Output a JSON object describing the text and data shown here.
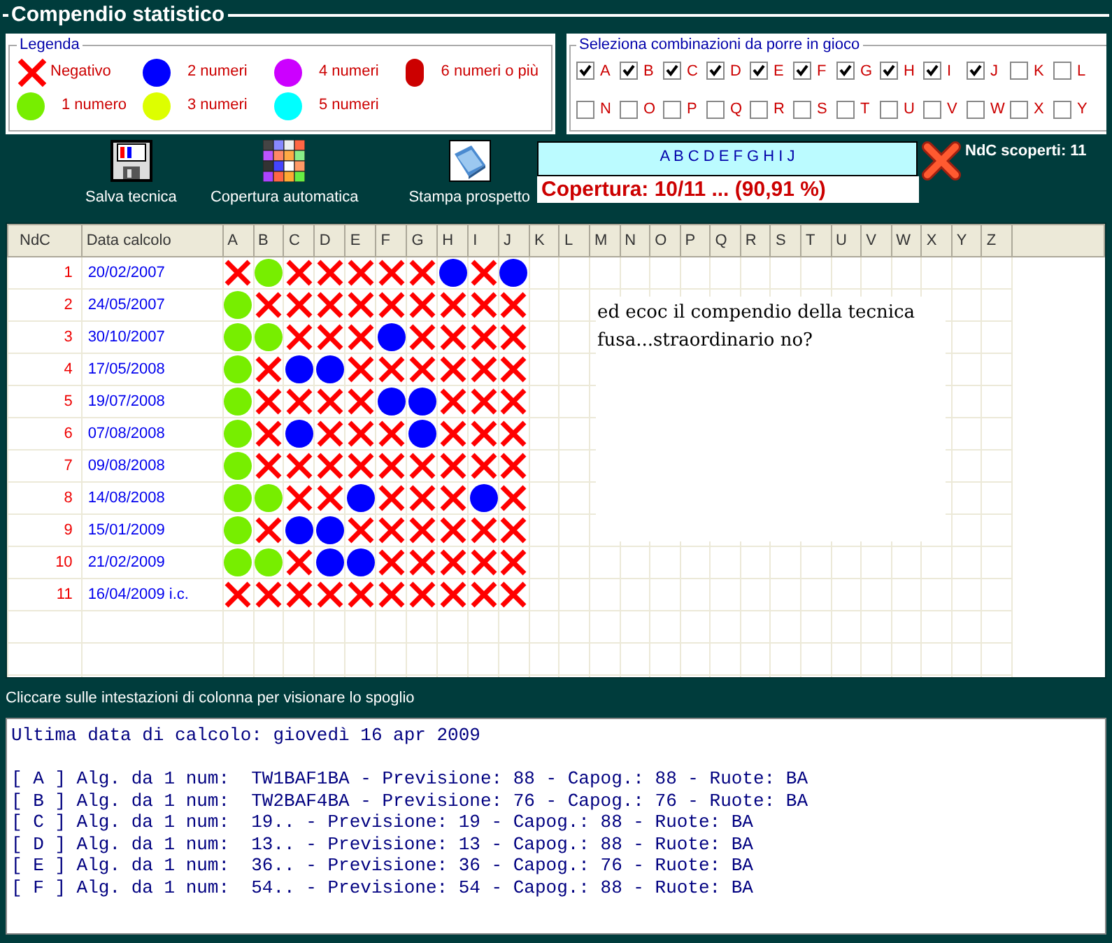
{
  "window": {
    "title": "Compendio statistico"
  },
  "legend": {
    "title": "Legenda",
    "items": [
      {
        "kind": "cross",
        "label": "Negativo",
        "color": "#ff0000"
      },
      {
        "kind": "dot",
        "label": "2 numeri",
        "color": "#0000ff"
      },
      {
        "kind": "dot",
        "label": "4 numeri",
        "color": "#cc00ff"
      },
      {
        "kind": "dot",
        "label": "6 numeri o più",
        "color": "#cc0000"
      },
      {
        "kind": "dot",
        "label": "1 numero",
        "color": "#77ee00"
      },
      {
        "kind": "dot",
        "label": "3 numeri",
        "color": "#ddff00"
      },
      {
        "kind": "dot",
        "label": "5 numeri",
        "color": "#00ffff"
      }
    ]
  },
  "selection": {
    "title": "Seleziona combinazioni da porre in gioco",
    "rows": [
      [
        {
          "label": "A",
          "checked": true
        },
        {
          "label": "B",
          "checked": true
        },
        {
          "label": "C",
          "checked": true
        },
        {
          "label": "D",
          "checked": true
        },
        {
          "label": "E",
          "checked": true
        },
        {
          "label": "F",
          "checked": true
        },
        {
          "label": "G",
          "checked": true
        },
        {
          "label": "H",
          "checked": true
        },
        {
          "label": "I",
          "checked": true
        },
        {
          "label": "J",
          "checked": true
        },
        {
          "label": "K",
          "checked": false
        },
        {
          "label": "L",
          "checked": false
        }
      ],
      [
        {
          "label": "N",
          "checked": false
        },
        {
          "label": "O",
          "checked": false
        },
        {
          "label": "P",
          "checked": false
        },
        {
          "label": "Q",
          "checked": false
        },
        {
          "label": "R",
          "checked": false
        },
        {
          "label": "S",
          "checked": false
        },
        {
          "label": "T",
          "checked": false
        },
        {
          "label": "U",
          "checked": false
        },
        {
          "label": "V",
          "checked": false
        },
        {
          "label": "W",
          "checked": false
        },
        {
          "label": "X",
          "checked": false
        },
        {
          "label": "Y",
          "checked": false
        }
      ]
    ]
  },
  "toolbar": [
    {
      "kind": "floppy",
      "label": "Salva tecnica"
    },
    {
      "kind": "palette",
      "label": "Copertura automatica"
    },
    {
      "kind": "book",
      "label": "Stampa prospetto"
    }
  ],
  "combination": "A B C D E F G H I J",
  "uncovered": "NdC scoperti: 11",
  "coverage": "Copertura: 10/11 ... (90,91 %)",
  "table": {
    "columns": [
      "NdC",
      "Data calcolo",
      "A",
      "B",
      "C",
      "D",
      "E",
      "F",
      "G",
      "H",
      "I",
      "J",
      "K",
      "L",
      "M",
      "N",
      "O",
      "P",
      "Q",
      "R",
      "S",
      "T",
      "U",
      "V",
      "W",
      "X",
      "Y",
      "Z"
    ],
    "rows": [
      {
        "ndc": "1",
        "date": "20/02/2007",
        "cells": [
          {
            "kind": "neg"
          },
          {
            "kind": "one"
          },
          {
            "kind": "neg"
          },
          {
            "kind": "neg"
          },
          {
            "kind": "neg"
          },
          {
            "kind": "neg"
          },
          {
            "kind": "neg"
          },
          {
            "kind": "two"
          },
          {
            "kind": "neg"
          },
          {
            "kind": "two"
          }
        ]
      },
      {
        "ndc": "2",
        "date": "24/05/2007",
        "cells": [
          {
            "kind": "one"
          },
          {
            "kind": "neg"
          },
          {
            "kind": "neg"
          },
          {
            "kind": "neg"
          },
          {
            "kind": "neg"
          },
          {
            "kind": "neg"
          },
          {
            "kind": "neg"
          },
          {
            "kind": "neg"
          },
          {
            "kind": "neg"
          },
          {
            "kind": "neg"
          }
        ]
      },
      {
        "ndc": "3",
        "date": "30/10/2007",
        "cells": [
          {
            "kind": "one"
          },
          {
            "kind": "one"
          },
          {
            "kind": "neg"
          },
          {
            "kind": "neg"
          },
          {
            "kind": "neg"
          },
          {
            "kind": "two"
          },
          {
            "kind": "neg"
          },
          {
            "kind": "neg"
          },
          {
            "kind": "neg"
          },
          {
            "kind": "neg"
          }
        ]
      },
      {
        "ndc": "4",
        "date": "17/05/2008",
        "cells": [
          {
            "kind": "one"
          },
          {
            "kind": "neg"
          },
          {
            "kind": "two"
          },
          {
            "kind": "two"
          },
          {
            "kind": "neg"
          },
          {
            "kind": "neg"
          },
          {
            "kind": "neg"
          },
          {
            "kind": "neg"
          },
          {
            "kind": "neg"
          },
          {
            "kind": "neg"
          }
        ]
      },
      {
        "ndc": "5",
        "date": "19/07/2008",
        "cells": [
          {
            "kind": "one"
          },
          {
            "kind": "neg"
          },
          {
            "kind": "neg"
          },
          {
            "kind": "neg"
          },
          {
            "kind": "neg"
          },
          {
            "kind": "two"
          },
          {
            "kind": "two"
          },
          {
            "kind": "neg"
          },
          {
            "kind": "neg"
          },
          {
            "kind": "neg"
          }
        ]
      },
      {
        "ndc": "6",
        "date": "07/08/2008",
        "cells": [
          {
            "kind": "one"
          },
          {
            "kind": "neg"
          },
          {
            "kind": "two"
          },
          {
            "kind": "neg"
          },
          {
            "kind": "neg"
          },
          {
            "kind": "neg"
          },
          {
            "kind": "two"
          },
          {
            "kind": "neg"
          },
          {
            "kind": "neg"
          },
          {
            "kind": "neg"
          }
        ]
      },
      {
        "ndc": "7",
        "date": "09/08/2008",
        "cells": [
          {
            "kind": "one"
          },
          {
            "kind": "neg"
          },
          {
            "kind": "neg"
          },
          {
            "kind": "neg"
          },
          {
            "kind": "neg"
          },
          {
            "kind": "neg"
          },
          {
            "kind": "neg"
          },
          {
            "kind": "neg"
          },
          {
            "kind": "neg"
          },
          {
            "kind": "neg"
          }
        ]
      },
      {
        "ndc": "8",
        "date": "14/08/2008",
        "cells": [
          {
            "kind": "one"
          },
          {
            "kind": "one"
          },
          {
            "kind": "neg"
          },
          {
            "kind": "neg"
          },
          {
            "kind": "two"
          },
          {
            "kind": "neg"
          },
          {
            "kind": "neg"
          },
          {
            "kind": "neg"
          },
          {
            "kind": "two"
          },
          {
            "kind": "neg"
          }
        ]
      },
      {
        "ndc": "9",
        "date": "15/01/2009",
        "cells": [
          {
            "kind": "one"
          },
          {
            "kind": "neg"
          },
          {
            "kind": "two"
          },
          {
            "kind": "two"
          },
          {
            "kind": "neg"
          },
          {
            "kind": "neg"
          },
          {
            "kind": "neg"
          },
          {
            "kind": "neg"
          },
          {
            "kind": "neg"
          },
          {
            "kind": "neg"
          }
        ]
      },
      {
        "ndc": "10",
        "date": "21/02/2009",
        "cells": [
          {
            "kind": "one"
          },
          {
            "kind": "one"
          },
          {
            "kind": "neg"
          },
          {
            "kind": "two"
          },
          {
            "kind": "two"
          },
          {
            "kind": "neg"
          },
          {
            "kind": "neg"
          },
          {
            "kind": "neg"
          },
          {
            "kind": "neg"
          },
          {
            "kind": "neg"
          }
        ]
      },
      {
        "ndc": "11",
        "date": "16/04/2009 i.c.",
        "cells": [
          {
            "kind": "neg"
          },
          {
            "kind": "neg"
          },
          {
            "kind": "neg"
          },
          {
            "kind": "neg"
          },
          {
            "kind": "neg"
          },
          {
            "kind": "neg"
          },
          {
            "kind": "neg"
          },
          {
            "kind": "neg"
          },
          {
            "kind": "neg"
          },
          {
            "kind": "neg"
          }
        ]
      }
    ]
  },
  "note": "ed ecoc il compendio della tecnica fusa...straordinario no?",
  "hint": "Cliccare sulle intestazioni di colonna per visionare lo spoglio",
  "output": {
    "header": "Ultima data di calcolo: giovedì 16 apr 2009",
    "lines": [
      "[ A ] Alg. da 1 num:  TW1BAF1BA - Previsione: 88 - Capog.: 88 - Ruote: BA",
      "[ B ] Alg. da 1 num:  TW2BAF4BA - Previsione: 76 - Capog.: 76 - Ruote: BA",
      "[ C ] Alg. da 1 num:  19.. - Previsione: 19 - Capog.: 88 - Ruote: BA",
      "[ D ] Alg. da 1 num:  13.. - Previsione: 13 - Capog.: 88 - Ruote: BA",
      "[ E ] Alg. da 1 num:  36.. - Previsione: 36 - Capog.: 76 - Ruote: BA",
      "[ F ] Alg. da 1 num:  54.. - Previsione: 54 - Capog.: 88 - Ruote: BA"
    ]
  }
}
